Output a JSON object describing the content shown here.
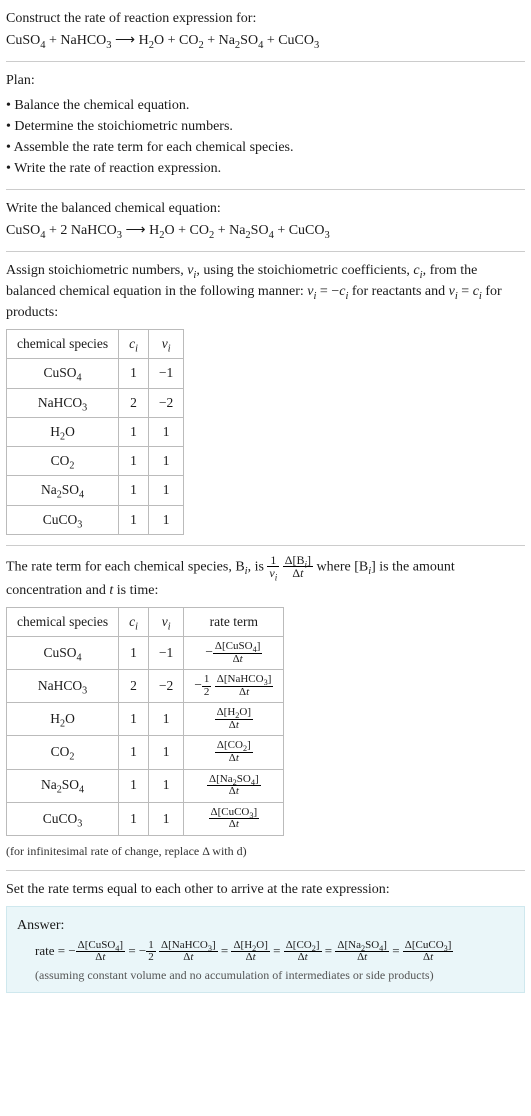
{
  "intro": {
    "line1": "Construct the rate of reaction expression for:",
    "eq_lhs": "CuSO",
    "plan_label": "Plan:",
    "bullets": [
      "• Balance the chemical equation.",
      "• Determine the stoichiometric numbers.",
      "• Assemble the rate term for each chemical species.",
      "• Write the rate of reaction expression."
    ],
    "balanced_label": "Write the balanced chemical equation:"
  },
  "stoich": {
    "assign_prefix": "Assign stoichiometric numbers, ",
    "assign_mid1": ", using the stoichiometric coefficients, ",
    "assign_mid2": ", from the balanced chemical equation in the following manner: ",
    "assign_reactants": " for reactants and ",
    "assign_products": " for products:",
    "headers": {
      "h1": "chemical species",
      "h2": "cᵢ",
      "h3": "νᵢ"
    },
    "rows": [
      {
        "sp": "CuSO₄",
        "c": "1",
        "v": "−1"
      },
      {
        "sp": "NaHCO₃",
        "c": "2",
        "v": "−2"
      },
      {
        "sp": "H₂O",
        "c": "1",
        "v": "1"
      },
      {
        "sp": "CO₂",
        "c": "1",
        "v": "1"
      },
      {
        "sp": "Na₂SO₄",
        "c": "1",
        "v": "1"
      },
      {
        "sp": "CuCO₃",
        "c": "1",
        "v": "1"
      }
    ]
  },
  "rate": {
    "text_prefix": "The rate term for each chemical species, B",
    "text_mid": ", is ",
    "text_where": " where [B",
    "text_suffix": "] is the amount concentration and ",
    "text_time": " is time:",
    "headers": {
      "h1": "chemical species",
      "h2": "cᵢ",
      "h3": "νᵢ",
      "h4": "rate term"
    },
    "rows": [
      {
        "sp": "CuSO₄",
        "c": "1",
        "v": "−1",
        "num": "Δ[CuSO₄]",
        "den": "Δt",
        "pre": "−"
      },
      {
        "sp": "NaHCO₃",
        "c": "2",
        "v": "−2",
        "num": "Δ[NaHCO₃]",
        "den": "Δt",
        "pre": "−½"
      },
      {
        "sp": "H₂O",
        "c": "1",
        "v": "1",
        "num": "Δ[H₂O]",
        "den": "Δt",
        "pre": ""
      },
      {
        "sp": "CO₂",
        "c": "1",
        "v": "1",
        "num": "Δ[CO₂]",
        "den": "Δt",
        "pre": ""
      },
      {
        "sp": "Na₂SO₄",
        "c": "1",
        "v": "1",
        "num": "Δ[Na₂SO₄]",
        "den": "Δt",
        "pre": ""
      },
      {
        "sp": "CuCO₃",
        "c": "1",
        "v": "1",
        "num": "Δ[CuCO₃]",
        "den": "Δt",
        "pre": ""
      }
    ],
    "footnote": "(for infinitesimal rate of change, replace Δ with d)"
  },
  "final": {
    "set_equal": "Set the rate terms equal to each other to arrive at the rate expression:",
    "answer_label": "Answer:",
    "rate_word": "rate = ",
    "note": "(assuming constant volume and no accumulation of intermediates or side products)"
  },
  "chart_data": {
    "type": "table",
    "tables": [
      {
        "title": "stoichiometric numbers",
        "columns": [
          "chemical species",
          "c_i",
          "nu_i"
        ],
        "rows": [
          [
            "CuSO4",
            1,
            -1
          ],
          [
            "NaHCO3",
            2,
            -2
          ],
          [
            "H2O",
            1,
            1
          ],
          [
            "CO2",
            1,
            1
          ],
          [
            "Na2SO4",
            1,
            1
          ],
          [
            "CuCO3",
            1,
            1
          ]
        ]
      },
      {
        "title": "rate terms",
        "columns": [
          "chemical species",
          "c_i",
          "nu_i",
          "rate term"
        ],
        "rows": [
          [
            "CuSO4",
            1,
            -1,
            "-Δ[CuSO4]/Δt"
          ],
          [
            "NaHCO3",
            2,
            -2,
            "-(1/2)Δ[NaHCO3]/Δt"
          ],
          [
            "H2O",
            1,
            1,
            "Δ[H2O]/Δt"
          ],
          [
            "CO2",
            1,
            1,
            "Δ[CO2]/Δt"
          ],
          [
            "Na2SO4",
            1,
            1,
            "Δ[Na2SO4]/Δt"
          ],
          [
            "CuCO3",
            1,
            1,
            "Δ[CuCO3]/Δt"
          ]
        ]
      }
    ]
  }
}
